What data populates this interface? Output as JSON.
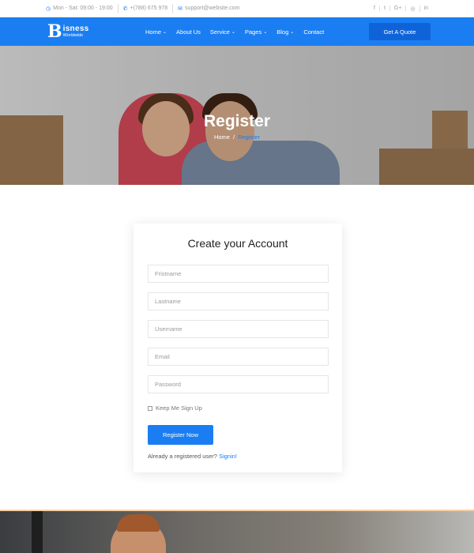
{
  "topbar": {
    "hours": "Mon - Sat: 09:00 - 19:00",
    "phone": "+(788) 675 978",
    "email": "support@website.com",
    "social": [
      "f",
      "t",
      "G+",
      "◎",
      "in"
    ]
  },
  "header": {
    "logo_letter": "B",
    "logo_name": "isness",
    "logo_sub": "Worldwide",
    "nav": [
      {
        "label": "Home",
        "dropdown": "⌄"
      },
      {
        "label": "About Us",
        "dropdown": ""
      },
      {
        "label": "Service",
        "dropdown": "⌄"
      },
      {
        "label": "Pages",
        "dropdown": "⌄"
      },
      {
        "label": "Blog",
        "dropdown": "⌄"
      },
      {
        "label": "Contact",
        "dropdown": ""
      }
    ],
    "quote_button": "Get A Quote"
  },
  "hero": {
    "title": "Register",
    "crumb_home": "Home",
    "crumb_sep": "/",
    "crumb_current": "Register"
  },
  "form": {
    "title": "Create your Account",
    "firstname_placeholder": "Fristname",
    "lastname_placeholder": "Lastname",
    "username_placeholder": "Username",
    "email_placeholder": "Email",
    "password_placeholder": "Password",
    "keep_label": "Keep Me Sign Up",
    "submit": "Register Now",
    "already_text": "Already a registered user?",
    "signin_link": "Signin!"
  },
  "colors": {
    "accent": "#1a7ef2",
    "quote_button": "#0f63d8"
  }
}
